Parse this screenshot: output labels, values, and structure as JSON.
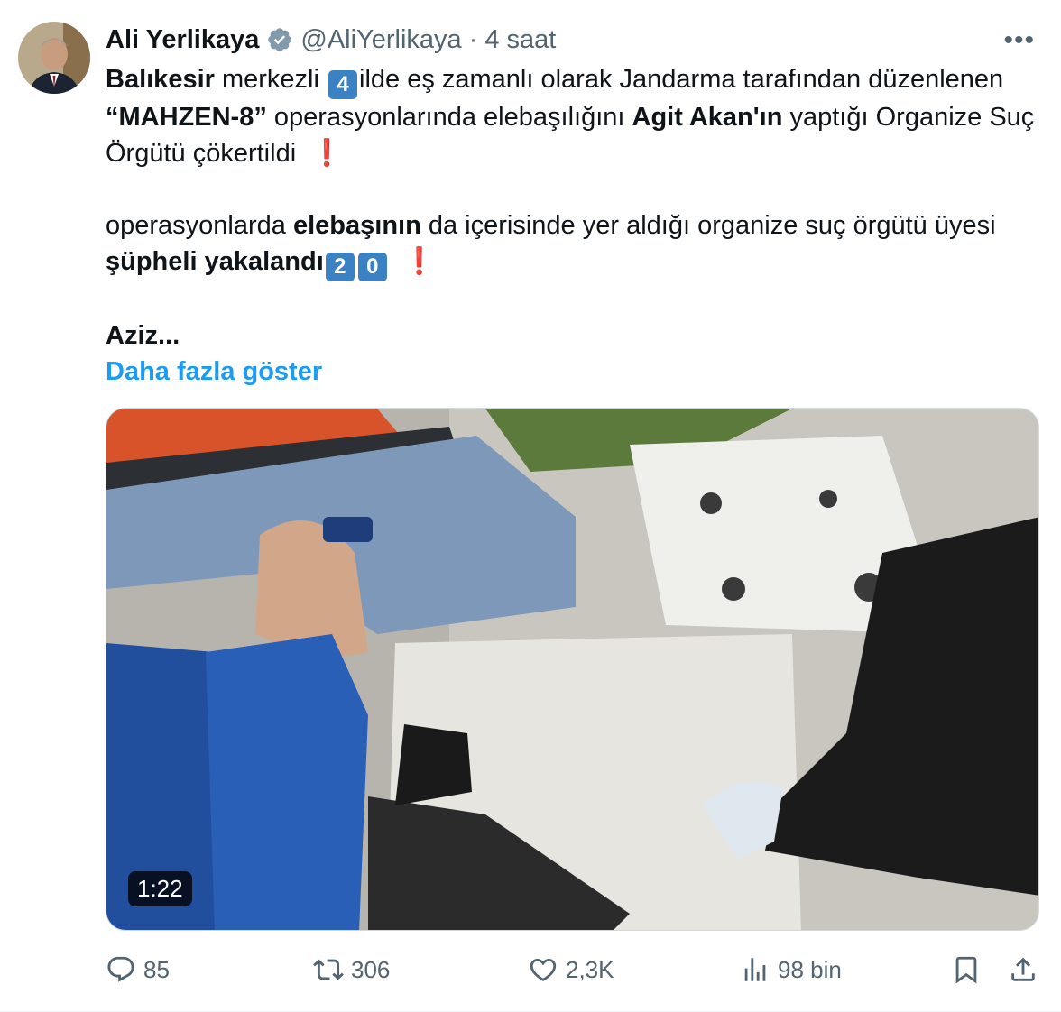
{
  "tweet": {
    "author_name": "Ali Yerlikaya",
    "author_handle": "@AliYerlikaya",
    "separator": "·",
    "time": "4 saat",
    "more_label": "•••",
    "para1": {
      "t1": "Balıkesir",
      "t2": " merkezli ",
      "k1": "4",
      "t3": "ilde eş zamanlı olarak Jandarma tarafından düzenlenen ",
      "t4": "“MAHZEN-8”",
      "t5": " operasyonlarında elebaşılığını ",
      "t6": "Agit Akan'ın",
      "t7": " yaptığı Organize Suç Örgütü çökertildi  ",
      "e1": "❗"
    },
    "para2": {
      "t1": "operasyonlarda ",
      "t2": "elebaşının",
      "t3": " da içerisinde yer aldığı organize suç örgütü üyesi ",
      "t4": "şüpheli yakalandı",
      "k1": "2",
      "k2": "0",
      "t5": "  ",
      "e1": "❗"
    },
    "para3": "Aziz...",
    "show_more": "Daha fazla göster"
  },
  "media": {
    "duration": "1:22"
  },
  "actions": {
    "replies": "85",
    "reposts": "306",
    "likes": "2,3K",
    "views": "98 bin"
  },
  "colors": {
    "accent": "#1d9bf0",
    "muted": "#536471",
    "keycap": "#3b82c4",
    "exclamation": "#d6182a"
  },
  "icons": [
    "verified-badge-icon",
    "more-icon",
    "reply-icon",
    "repost-icon",
    "like-icon",
    "views-icon",
    "bookmark-icon",
    "share-icon"
  ]
}
